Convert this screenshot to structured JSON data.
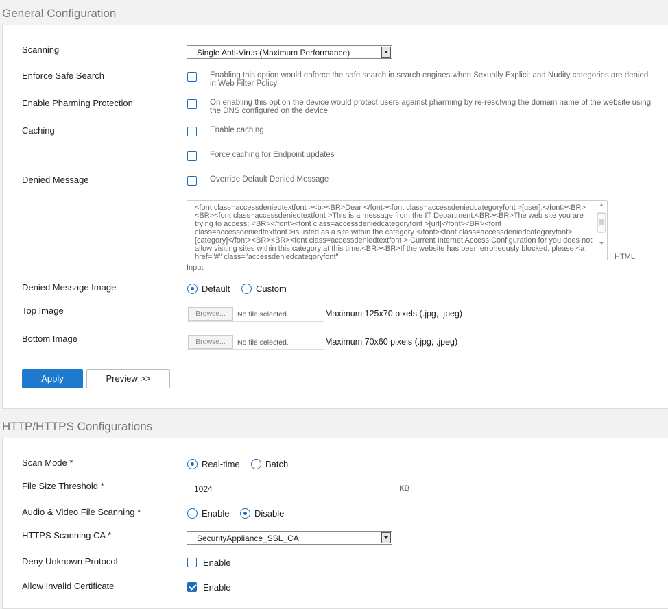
{
  "general": {
    "title": "General Configuration",
    "scanning": {
      "label": "Scanning",
      "value": "Single Anti-Virus (Maximum Performance)"
    },
    "safe_search": {
      "label": "Enforce Safe Search",
      "desc": "Enabling this option would enforce the safe search in search engines when Sexually Explicit and Nudity categories are denied in Web Filter Policy",
      "checked": false
    },
    "pharming": {
      "label": "Enable Pharming Protection",
      "desc": "On enabling this option the device would protect users against pharming by re-resolving the domain name of the website using the DNS configured on the device",
      "checked": false
    },
    "caching": {
      "label": "Caching",
      "enable_label": "Enable caching",
      "endpoint_label": "Force caching for Endpoint updates"
    },
    "denied_message": {
      "label": "Denied Message",
      "override_label": "Override Default Denied Message",
      "html_text": "<font class=accessdeniedtextfont ><b><BR>Dear </font><font class=accessdeniedcategoryfont >[user],</font><BR><BR><font class=accessdeniedtextfont >This is a message from the IT Department.<BR><BR>The web site you are trying to access: <BR></font><font class=accessdeniedcategoryfont >[url]</font><BR><font class=accessdeniedtextfont >is listed as a site within the category </font><font class=accessdeniedcategoryfont>[category]</font><BR><BR><font class=accessdeniedtextfont > Current Internet Access Configuration for you does not allow visiting sites within this category at this time.<BR><BR>If the website has been erroneously blocked, please <a href=\"#\" class=\"accessdeniedcategoryfont\"",
      "html_label": "HTML",
      "input_label": "Input"
    },
    "denied_image": {
      "label": "Denied Message Image",
      "default_label": "Default",
      "custom_label": "Custom",
      "selected": "Default"
    },
    "top_image": {
      "label": "Top Image",
      "browse": "Browse...",
      "file": "No file selected.",
      "hint": "Maximum 125x70 pixels (.jpg, .jpeg)"
    },
    "bottom_image": {
      "label": "Bottom Image",
      "browse": "Browse...",
      "file": "No file selected.",
      "hint": "Maximum 70x60 pixels (.jpg, .jpeg)"
    },
    "apply": "Apply",
    "preview": "Preview >>"
  },
  "http": {
    "title": "HTTP/HTTPS Configurations",
    "scan_mode": {
      "label": "Scan Mode *",
      "realtime": "Real-time",
      "batch": "Batch",
      "selected": "Real-time"
    },
    "file_size": {
      "label": "File Size Threshold  *",
      "value": "1024",
      "unit": "KB"
    },
    "av_scanning": {
      "label": "Audio & Video File Scanning  *",
      "enable": "Enable",
      "disable": "Disable",
      "selected": "Disable"
    },
    "https_ca": {
      "label": "HTTPS Scanning CA *",
      "value": "SecurityAppliance_SSL_CA"
    },
    "deny_unknown": {
      "label": "Deny Unknown Protocol",
      "option": "Enable",
      "checked": false
    },
    "allow_invalid": {
      "label": "Allow Invalid Certificate",
      "option": "Enable",
      "checked": true
    }
  },
  "colors": {
    "accent": "#1e7acc",
    "checkbox": "#1e6fb7",
    "panel_bg": "#ffffff",
    "page_bg": "#f2f2f2"
  }
}
